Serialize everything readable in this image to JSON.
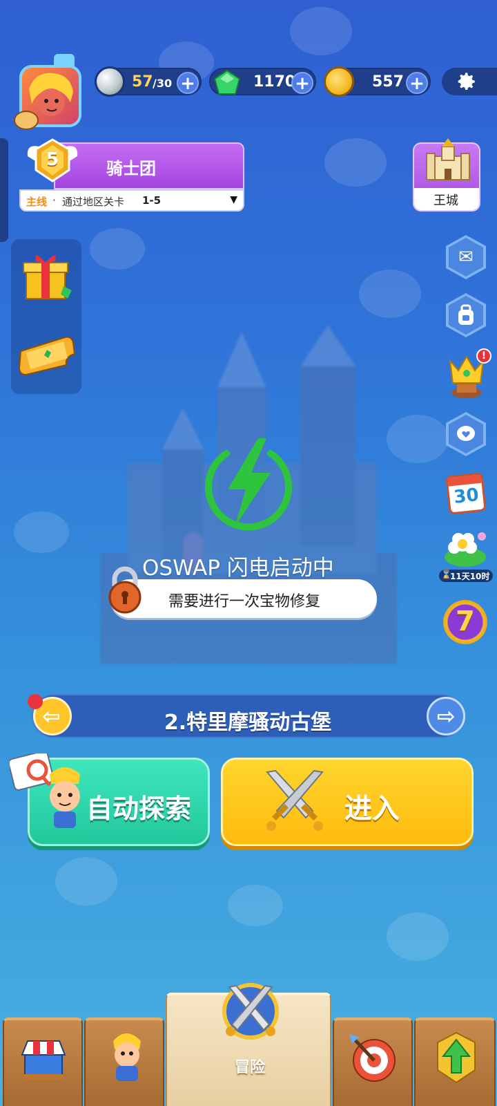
{
  "resources": {
    "stamina": {
      "current": "57",
      "max": "/30"
    },
    "gems": "1170",
    "coins": "557"
  },
  "guild": {
    "level": "5",
    "name": "骑士团"
  },
  "quest": {
    "tag": "主线",
    "separator": "·",
    "text": "通过地区关卡",
    "stage": "1-5"
  },
  "castle_button": {
    "label": "王城"
  },
  "timer": {
    "text": "11天10时"
  },
  "calendar": {
    "day": "30"
  },
  "lucky_badge": {
    "number": "7"
  },
  "overlay": {
    "title": "OSWAP 闪电启动中"
  },
  "lock_banner": {
    "text": "需要进行一次宝物修复"
  },
  "level_nav": {
    "name": "2.特里摩骚动古堡"
  },
  "buttons": {
    "auto_explore": "自动探索",
    "enter": "进入"
  },
  "bottom_nav": {
    "active_label": "冒险"
  },
  "colors": {
    "accent_purple": "#b453e8",
    "green_button": "#2fd2a8",
    "yellow_button": "#ffc51a",
    "lightning": "#2ec43d"
  }
}
